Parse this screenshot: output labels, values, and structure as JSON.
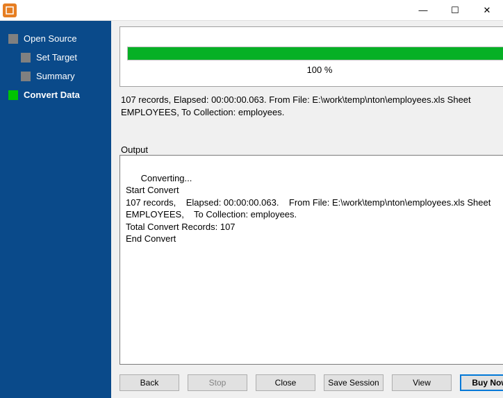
{
  "window": {
    "minimize": "—",
    "maximize": "☐",
    "close": "✕"
  },
  "sidebar": {
    "items": [
      {
        "label": "Open Source",
        "level": 1,
        "active": false
      },
      {
        "label": "Set Target",
        "level": 2,
        "active": false
      },
      {
        "label": "Summary",
        "level": 2,
        "active": false
      },
      {
        "label": "Convert Data",
        "level": 1,
        "active": true
      }
    ]
  },
  "progress": {
    "percent": 100,
    "label": "100 %"
  },
  "status": "107 records,    Elapsed: 00:00:00.063.    From File: E:\\work\\temp\\nton\\employees.xls Sheet EMPLOYEES,    To Collection: employees.",
  "output": {
    "label": "Output",
    "text": "Converting...\nStart Convert\n107 records,    Elapsed: 00:00:00.063.    From File: E:\\work\\temp\\nton\\employees.xls Sheet EMPLOYEES,    To Collection: employees.\nTotal Convert Records: 107\nEnd Convert"
  },
  "buttons": {
    "back": "Back",
    "stop": "Stop",
    "close": "Close",
    "save_session": "Save Session",
    "view": "View",
    "buy_now": "Buy Now"
  }
}
